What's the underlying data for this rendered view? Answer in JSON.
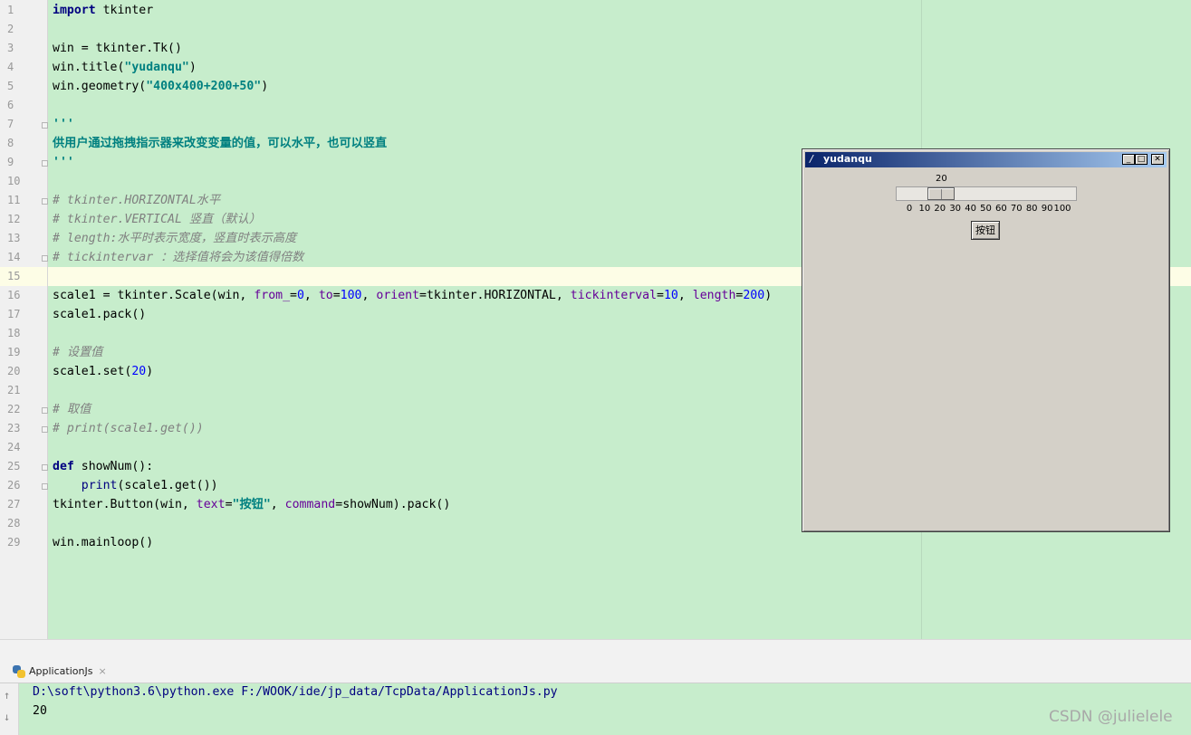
{
  "editor": {
    "line_numbers": [
      "1",
      "2",
      "3",
      "4",
      "5",
      "6",
      "7",
      "8",
      "9",
      "10",
      "11",
      "12",
      "13",
      "14",
      "15",
      "16",
      "17",
      "18",
      "19",
      "20",
      "21",
      "22",
      "23",
      "24",
      "25",
      "26",
      "27",
      "28",
      "29"
    ],
    "lines": [
      [
        {
          "t": "import",
          "c": "kw"
        },
        {
          "t": " tkinter",
          "c": ""
        }
      ],
      [],
      [
        {
          "t": "win = tkinter.Tk()",
          "c": ""
        }
      ],
      [
        {
          "t": "win.title(",
          "c": ""
        },
        {
          "t": "\"yudanqu\"",
          "c": "str"
        },
        {
          "t": ")",
          "c": ""
        }
      ],
      [
        {
          "t": "win.geometry(",
          "c": ""
        },
        {
          "t": "\"400x400+200+50\"",
          "c": "str"
        },
        {
          "t": ")",
          "c": ""
        }
      ],
      [],
      [
        {
          "t": "'''",
          "c": "str"
        }
      ],
      [
        {
          "t": "供用户通过拖拽指示器来改变变量的值，可以水平，也可以竖直",
          "c": "str"
        }
      ],
      [
        {
          "t": "'''",
          "c": "str"
        }
      ],
      [],
      [
        {
          "t": "# tkinter.HORIZONTAL水平",
          "c": "cmt"
        }
      ],
      [
        {
          "t": "# tkinter.VERTICAL 竖直（默认）",
          "c": "cmt"
        }
      ],
      [
        {
          "t": "# length:水平时表示宽度，竖直时表示高度",
          "c": "cmt"
        }
      ],
      [
        {
          "t": "# tickintervar ：选择值将会为该值得倍数",
          "c": "cmt"
        }
      ],
      [],
      [
        {
          "t": "scale1 = tkinter.Scale(win, ",
          "c": ""
        },
        {
          "t": "from_",
          "c": "param"
        },
        {
          "t": "=",
          "c": ""
        },
        {
          "t": "0",
          "c": "num"
        },
        {
          "t": ", ",
          "c": ""
        },
        {
          "t": "to",
          "c": "param"
        },
        {
          "t": "=",
          "c": ""
        },
        {
          "t": "100",
          "c": "num"
        },
        {
          "t": ", ",
          "c": ""
        },
        {
          "t": "orient",
          "c": "param"
        },
        {
          "t": "=tkinter.HORIZONTAL, ",
          "c": ""
        },
        {
          "t": "tickinterval",
          "c": "param"
        },
        {
          "t": "=",
          "c": ""
        },
        {
          "t": "10",
          "c": "num"
        },
        {
          "t": ", ",
          "c": ""
        },
        {
          "t": "length",
          "c": "param"
        },
        {
          "t": "=",
          "c": ""
        },
        {
          "t": "200",
          "c": "num"
        },
        {
          "t": ")",
          "c": ""
        }
      ],
      [
        {
          "t": "scale1.pack()",
          "c": ""
        }
      ],
      [],
      [
        {
          "t": "# 设置值",
          "c": "cmt"
        }
      ],
      [
        {
          "t": "scale1.set(",
          "c": ""
        },
        {
          "t": "20",
          "c": "num"
        },
        {
          "t": ")",
          "c": ""
        }
      ],
      [],
      [
        {
          "t": "# 取值",
          "c": "cmt"
        }
      ],
      [
        {
          "t": "# print(scale1.get())",
          "c": "cmt"
        }
      ],
      [],
      [
        {
          "t": "def",
          "c": "kw"
        },
        {
          "t": " showNum():",
          "c": ""
        }
      ],
      [
        {
          "t": "    ",
          "c": ""
        },
        {
          "t": "print",
          "c": "builtin"
        },
        {
          "t": "(scale1.get())",
          "c": ""
        }
      ],
      [
        {
          "t": "tkinter.Button(win, ",
          "c": ""
        },
        {
          "t": "text",
          "c": "param"
        },
        {
          "t": "=",
          "c": ""
        },
        {
          "t": "\"按钮\"",
          "c": "str"
        },
        {
          "t": ", ",
          "c": ""
        },
        {
          "t": "command",
          "c": "param"
        },
        {
          "t": "=showNum).pack()",
          "c": ""
        }
      ],
      [],
      [
        {
          "t": "win.mainloop()",
          "c": ""
        }
      ]
    ]
  },
  "tk_window": {
    "title": "yudanqu",
    "feather": "/",
    "controls": {
      "minimize": "_",
      "maximize": "□",
      "close": "✕"
    },
    "scale": {
      "value": 20,
      "value_label": "20",
      "from": 0,
      "to": 100,
      "ticks": [
        "0",
        "10",
        "20",
        "30",
        "40",
        "50",
        "60",
        "70",
        "80",
        "90",
        "100"
      ]
    },
    "button_label": "按钮"
  },
  "run_panel": {
    "tab_label": "ApplicationJs",
    "tab_close": "×",
    "up_arrow": "↑",
    "down_arrow": "↓",
    "command": "D:\\soft\\python3.6\\python.exe F:/WOOK/ide/jp_data/TcpData/ApplicationJs.py",
    "output": "20"
  },
  "watermark": "CSDN @julielele"
}
